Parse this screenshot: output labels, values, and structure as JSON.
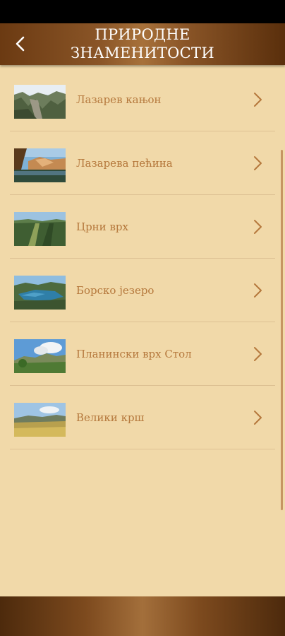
{
  "header": {
    "title_line1": "ПРИРОДНЕ",
    "title_line2": "ЗНАМЕНИТОСТИ",
    "back_icon": "chevron-left-icon"
  },
  "items": [
    {
      "label": "Лазарев кањон"
    },
    {
      "label": "Лазарева пећина"
    },
    {
      "label": "Црни врх"
    },
    {
      "label": "Борско језеро"
    },
    {
      "label": "Планински врх Стол"
    },
    {
      "label": "Велики крш"
    }
  ],
  "colors": {
    "background": "#f1d9a9",
    "item_text": "#b5783c",
    "header_brown": "#8a5527"
  }
}
